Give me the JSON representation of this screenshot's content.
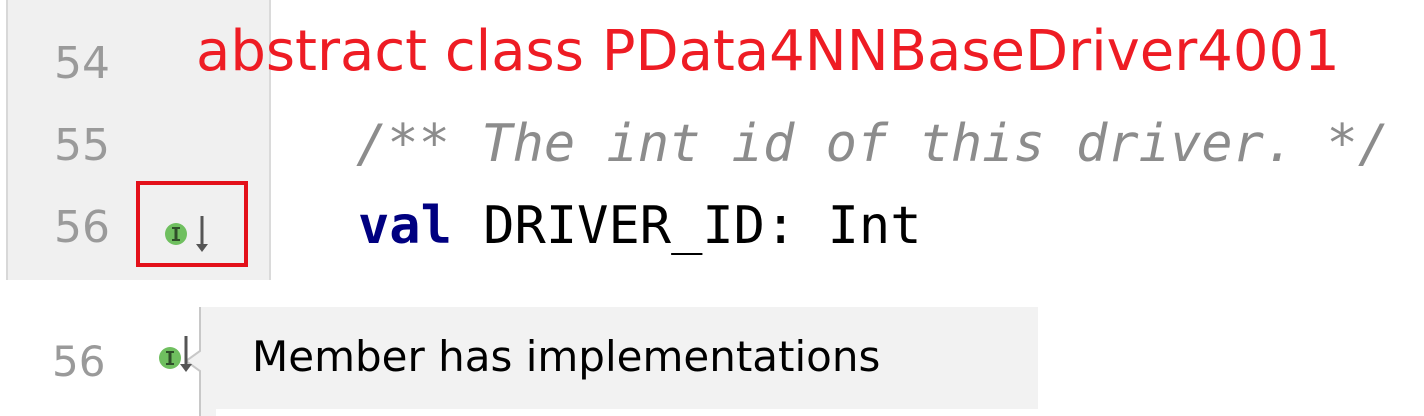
{
  "editor": {
    "lines": [
      {
        "number": "54",
        "text": "abstract class PData4NNBaseDriver4001"
      },
      {
        "number": "55",
        "text": "/** The int id of this driver. */"
      },
      {
        "number": "56",
        "keyword": "val",
        "rest": " DRIVER_ID: Int"
      }
    ],
    "gutter_icon": "implemented-member-icon",
    "highlight_color": "#e3101a",
    "class_text_color": "#ee1c24",
    "keyword_color": "#000080",
    "comment_color": "#8c8c8c"
  },
  "tooltip": {
    "line_number": "56",
    "icon": "implemented-member-icon",
    "text": "Member has implementations",
    "background": "#f2f2f2"
  }
}
